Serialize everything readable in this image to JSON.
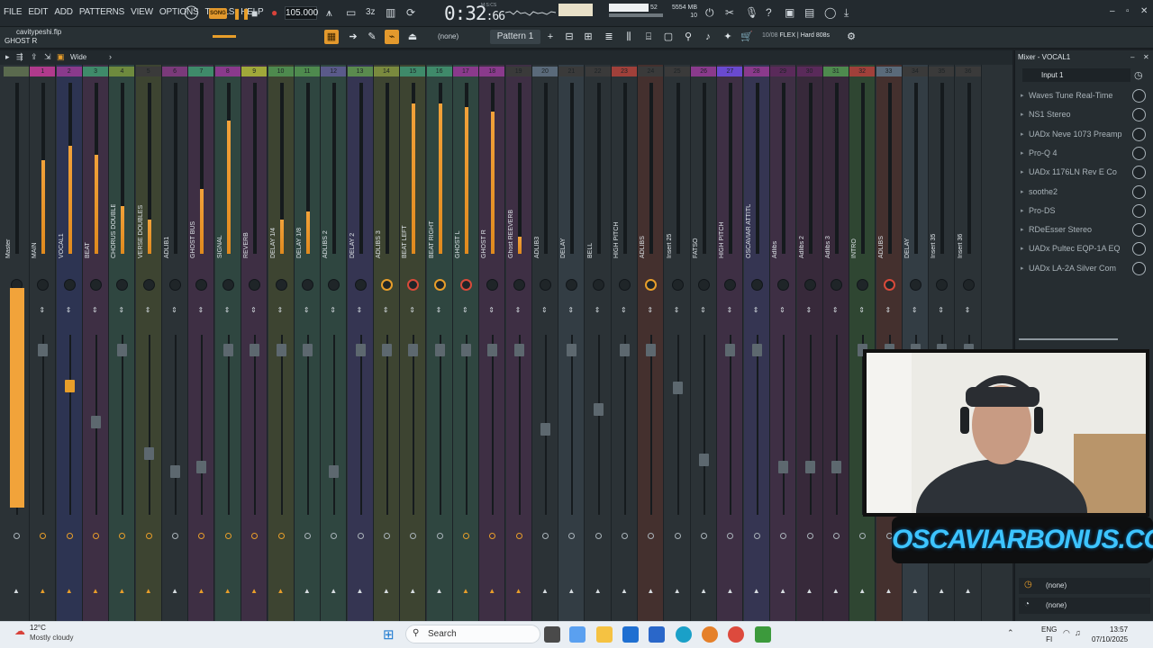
{
  "menu": [
    "FILE",
    "EDIT",
    "ADD",
    "PATTERNS",
    "VIEW",
    "OPTIONS",
    "TOOLS",
    "HELP"
  ],
  "transport": {
    "mode": "SONG",
    "tempo": "105.000",
    "time_main": "0:32",
    "time_sub": ":66",
    "time_label": "M:S:CS"
  },
  "cpu": {
    "polyphony": "52",
    "poly_sub": "10",
    "memory": "5554 MB",
    "memory_sub": "10"
  },
  "project": {
    "filename": "cavitypeshi.flp",
    "hint": "GHOST R"
  },
  "toolbar2": {
    "pattern": "Pattern 1",
    "selector": "(none)",
    "info_count": "10/08",
    "info_text": "FLEX | Hard 808s"
  },
  "mixer": {
    "view_mode": "Wide",
    "tracks": [
      {
        "num": "",
        "name": "Master",
        "color": "#2b3236",
        "meter": 0,
        "fader": 310,
        "knob": "",
        "io": ""
      },
      {
        "num": "1",
        "name": "MAIN",
        "color": "#2b3236",
        "meter": 0.55,
        "fader": 310,
        "knob": "",
        "io": "o"
      },
      {
        "num": "2",
        "name": "VOCAL1",
        "color": "#2d3452",
        "meter": 0.63,
        "fader": 350,
        "knob": "",
        "io": "o",
        "selected": true
      },
      {
        "num": "3",
        "name": "BEAT",
        "color": "#3e2f44",
        "meter": 0.58,
        "fader": 390,
        "knob": "",
        "io": "o"
      },
      {
        "num": "4",
        "name": "CHORUS DOUBLES",
        "color": "#2f4640",
        "meter": 0.28,
        "fader": 310,
        "knob": "",
        "io": "o"
      },
      {
        "num": "5",
        "name": "VERSE DOUBLES",
        "color": "#3d4431",
        "meter": 0.2,
        "fader": 425,
        "knob": "",
        "io": "o"
      },
      {
        "num": "6",
        "name": "ADLIB1",
        "color": "#2b3236",
        "meter": 0,
        "fader": 445,
        "knob": "",
        "io": ""
      },
      {
        "num": "7",
        "name": "GHOST BUS",
        "color": "#3e2f44",
        "meter": 0.38,
        "fader": 440,
        "knob": "",
        "io": "o"
      },
      {
        "num": "8",
        "name": "SIGNAL",
        "color": "#2f4640",
        "meter": 0.78,
        "fader": 310,
        "knob": "",
        "io": "o"
      },
      {
        "num": "9",
        "name": "REVERB",
        "color": "#3e2f44",
        "meter": 0,
        "fader": 310,
        "knob": "",
        "io": "o"
      },
      {
        "num": "10",
        "name": "DELAY 1/4",
        "color": "#3d4431",
        "meter": 0.2,
        "fader": 310,
        "knob": "",
        "io": "o"
      },
      {
        "num": "11",
        "name": "DELAY 1/8",
        "color": "#2f4640",
        "meter": 0.25,
        "fader": 310,
        "knob": "",
        "io": ""
      },
      {
        "num": "12",
        "name": "ADLIBS 2",
        "color": "#2f4640",
        "meter": 0,
        "fader": 445,
        "knob": "",
        "io": ""
      },
      {
        "num": "13",
        "name": "DELAY 2",
        "color": "#353552",
        "meter": 0,
        "fader": 310,
        "knob": "",
        "io": ""
      },
      {
        "num": "14",
        "name": "ADLIBS 3",
        "color": "#3d4431",
        "meter": 0,
        "fader": 310,
        "knob": "on",
        "io": ""
      },
      {
        "num": "15",
        "name": "BEAT LEFT",
        "color": "#3d4431",
        "meter": 0.88,
        "fader": 310,
        "knob": "red",
        "io": ""
      },
      {
        "num": "16",
        "name": "BEAT RIGHT",
        "color": "#2f4640",
        "meter": 0.88,
        "fader": 310,
        "knob": "on",
        "io": ""
      },
      {
        "num": "17",
        "name": "GHOST L",
        "color": "#2f4640",
        "meter": 0.86,
        "fader": 310,
        "knob": "red",
        "io": "o"
      },
      {
        "num": "18",
        "name": "GHOST R",
        "color": "#3e2f44",
        "meter": 0.83,
        "fader": 310,
        "knob": "",
        "io": "o"
      },
      {
        "num": "19",
        "name": "Ghost REEVERB",
        "color": "#3e2f44",
        "meter": 0.1,
        "fader": 310,
        "knob": "",
        "io": "o"
      },
      {
        "num": "20",
        "name": "ADLIB3",
        "color": "#2b3236",
        "meter": 0,
        "fader": 398,
        "knob": "",
        "io": ""
      },
      {
        "num": "21",
        "name": "DELAY",
        "color": "#333d44",
        "meter": 0,
        "fader": 310,
        "knob": "",
        "io": ""
      },
      {
        "num": "22",
        "name": "BELL",
        "color": "#2b3236",
        "meter": 0,
        "fader": 376,
        "knob": "",
        "io": ""
      },
      {
        "num": "23",
        "name": "HIGH PITCH",
        "color": "#2b3236",
        "meter": 0,
        "fader": 310,
        "knob": "",
        "io": ""
      },
      {
        "num": "24",
        "name": "ADLIBS",
        "color": "#44302e",
        "meter": 0,
        "fader": 310,
        "knob": "on",
        "io": ""
      },
      {
        "num": "25",
        "name": "Insert 25",
        "color": "#2b3236",
        "meter": 0,
        "fader": 352,
        "knob": "",
        "io": ""
      },
      {
        "num": "26",
        "name": "FATSO",
        "color": "#2b3236",
        "meter": 0,
        "fader": 432,
        "knob": "",
        "io": ""
      },
      {
        "num": "27",
        "name": "HIGH PITCH",
        "color": "#3e2f44",
        "meter": 0,
        "fader": 310,
        "knob": "",
        "io": ""
      },
      {
        "num": "28",
        "name": "OSCAVIAR ATTITUDE",
        "color": "#353552",
        "meter": 0,
        "fader": 310,
        "knob": "",
        "io": ""
      },
      {
        "num": "29",
        "name": "Adlibs",
        "color": "#3e2f44",
        "meter": 0,
        "fader": 440,
        "knob": "",
        "io": ""
      },
      {
        "num": "30",
        "name": "Adlibs 2",
        "color": "#37293a",
        "meter": 0,
        "fader": 440,
        "knob": "",
        "io": ""
      },
      {
        "num": "31",
        "name": "Adlibs 3",
        "color": "#37293a",
        "meter": 0,
        "fader": 440,
        "knob": "",
        "io": ""
      },
      {
        "num": "32",
        "name": "INTRO",
        "color": "#2f4632",
        "meter": 0,
        "fader": 310,
        "knob": "",
        "io": ""
      },
      {
        "num": "33",
        "name": "ADLIBS",
        "color": "#44302e",
        "meter": 0,
        "fader": 310,
        "knob": "red",
        "io": ""
      },
      {
        "num": "34",
        "name": "DELAY",
        "color": "#333d44",
        "meter": 0,
        "fader": 310,
        "knob": "",
        "io": ""
      },
      {
        "num": "35",
        "name": "Insert 35",
        "color": "#2b3236",
        "meter": 0,
        "fader": 310,
        "knob": "",
        "io": ""
      },
      {
        "num": "36",
        "name": "Insert 36",
        "color": "#2b3236",
        "meter": 0,
        "fader": 310,
        "knob": "",
        "io": ""
      }
    ]
  },
  "mixer_panel": {
    "title": "Mixer - VOCAL1",
    "input": "Input 1",
    "slots": [
      "Waves Tune Real-Time",
      "NS1 Stereo",
      "UADx Neve 1073 Preamp",
      "Pro-Q 4",
      "UADx 1176LN Rev E Co",
      "soothe2",
      "Pro-DS",
      "RDeEsser Stereo",
      "UADx Pultec EQP-1A EQ",
      "UADx LA-2A Silver Com"
    ],
    "out1": "(none)",
    "out2": "(none)"
  },
  "overlay": {
    "brand": "OSCAVIARBONUS.COM"
  },
  "taskbar": {
    "temp": "12°C",
    "weather": "Mostly cloudy",
    "search_placeholder": "Search",
    "lang1": "ENG",
    "lang2": "FI",
    "time": "13:57",
    "date": "07/10/2025"
  }
}
